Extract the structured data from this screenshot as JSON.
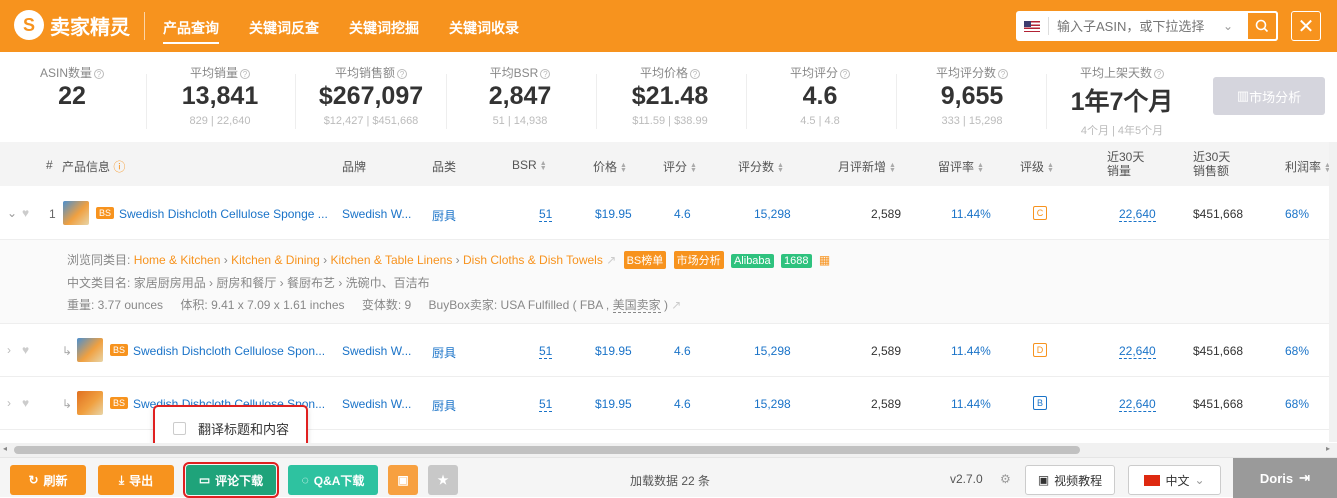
{
  "app": {
    "logo_text": "卖家精灵",
    "logo_mark": "S"
  },
  "nav": [
    "产品查询",
    "关键词反查",
    "关键词挖掘",
    "关键词收录"
  ],
  "search": {
    "placeholder": "输入子ASIN，或下拉选择",
    "dropdown": "⌄",
    "icon": "search-icon"
  },
  "close": "✕",
  "stats": [
    {
      "label": "ASIN数量",
      "value": "22",
      "range": ""
    },
    {
      "label": "平均销量",
      "value": "13,841",
      "range": "829 | 22,640"
    },
    {
      "label": "平均销售额",
      "value": "$267,097",
      "range": "$12,427 | $451,668"
    },
    {
      "label": "平均BSR",
      "value": "2,847",
      "range": "51 | 14,938"
    },
    {
      "label": "平均价格",
      "value": "$21.48",
      "range": "$11.59 | $38.99"
    },
    {
      "label": "平均评分",
      "value": "4.6",
      "range": "4.5 | 4.8"
    },
    {
      "label": "平均评分数",
      "value": "9,655",
      "range": "333 | 15,298"
    },
    {
      "label": "平均上架天数",
      "value": "1年7个月",
      "range": "4个月 | 4年5个月"
    }
  ],
  "market_btn": "市场分析",
  "headers": {
    "idx": "#",
    "info": "产品信息",
    "brand": "品牌",
    "cat": "品类",
    "bsr": "BSR",
    "price": "价格",
    "rating": "评分",
    "reviews": "评分数",
    "monthly": "月评新增",
    "retention": "留评率",
    "grade": "评级",
    "sales30": "近30天\n销量",
    "revenue30": "近30天\n销售额",
    "margin": "利润率"
  },
  "rows": [
    {
      "idx": "1",
      "badge": "BS",
      "title": "Swedish Dishcloth Cellulose Sponge ...",
      "brand": "Swedish W...",
      "cat": "厨具",
      "bsr": "51",
      "price": "$19.95",
      "rating": "4.6",
      "reviews": "15,298",
      "monthly": "2,589",
      "retention": "11.44%",
      "grade": "C",
      "sales": "22,640",
      "revenue": "$451,668",
      "margin": "68%"
    },
    {
      "idx": "",
      "badge": "BS",
      "title": "Swedish Dishcloth Cellulose Spon...",
      "brand": "Swedish W...",
      "cat": "厨具",
      "bsr": "51",
      "price": "$19.95",
      "rating": "4.6",
      "reviews": "15,298",
      "monthly": "2,589",
      "retention": "11.44%",
      "grade": "D",
      "sales": "22,640",
      "revenue": "$451,668",
      "margin": "68%"
    },
    {
      "idx": "",
      "badge": "BS",
      "title": "Swedish Dishcloth Cellulose Spon...",
      "brand": "Swedish W...",
      "cat": "厨具",
      "bsr": "51",
      "price": "$19.95",
      "rating": "4.6",
      "reviews": "15,298",
      "monthly": "2,589",
      "retention": "11.44%",
      "grade": "B",
      "sales": "22,640",
      "revenue": "$451,668",
      "margin": "68%"
    }
  ],
  "detail": {
    "browse_label": "浏览同类目:",
    "path": [
      "Home & Kitchen",
      "Kitchen & Dining",
      "Kitchen & Table Linens",
      "Dish Cloths & Dish Towels"
    ],
    "tags": [
      "BS榜单",
      "市场分析",
      "Alibaba",
      "1688"
    ],
    "cn_label": "中文类目名:",
    "cn_path": "家居厨房用品 › 厨房和餐厅 › 餐厨布艺 › 洗碗巾、百洁布",
    "weight": "重量: 3.77 ounces",
    "volume": "体积: 9.41 x 7.09 x 1.61 inches",
    "variants": "变体数: 9",
    "buybox": "BuyBox卖家: USA Fulfilled ( FBA , ",
    "buybox_link": "美国卖家",
    "buybox_end": " )"
  },
  "popup": {
    "label": "翻译标题和内容"
  },
  "bottom": {
    "refresh": "刷新",
    "export": "导出",
    "reviews": "评论下载",
    "qa": "Q&A下载",
    "loaded": "加载数据 22 条",
    "version": "v2.7.0",
    "video": "视频教程",
    "lang": "中文",
    "user": "Doris"
  }
}
